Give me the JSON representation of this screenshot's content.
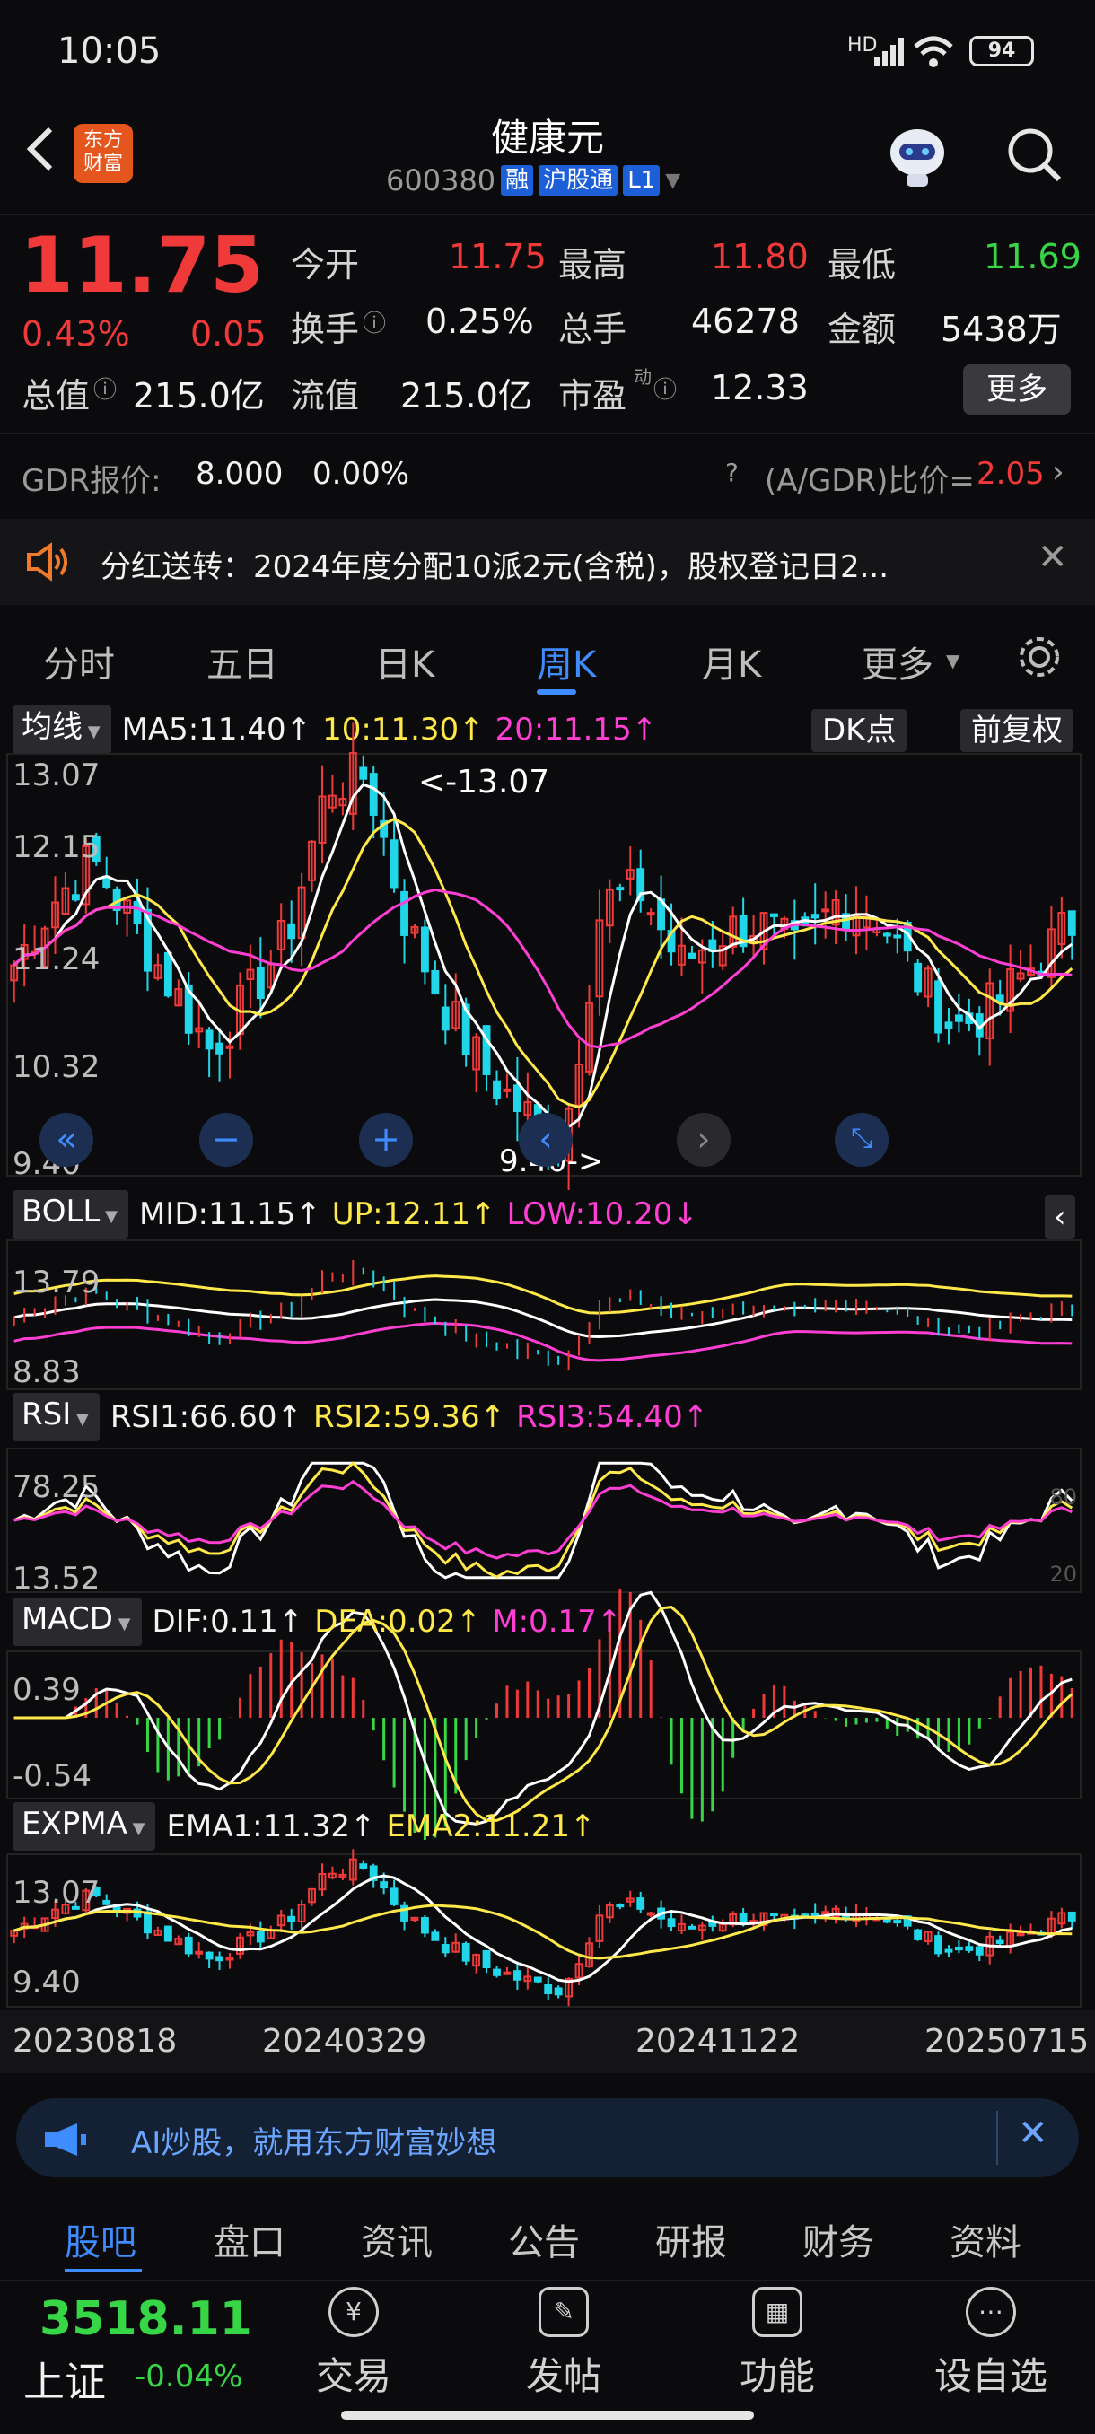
{
  "status_bar": {
    "time": "10:05",
    "battery": "94",
    "network": "HD"
  },
  "header": {
    "title": "健康元",
    "code": "600380",
    "tags": [
      "融",
      "沪股通",
      "L1"
    ],
    "logo_text": "东方\n财富"
  },
  "quote": {
    "price": "11.75",
    "change_pct": "0.43%",
    "change": "0.05",
    "open_label": "今开",
    "open": "11.75",
    "high_label": "最高",
    "high": "11.80",
    "low_label": "最低",
    "low": "11.69",
    "turnover_label": "换手",
    "turnover": "0.25%",
    "volume_label": "总手",
    "volume": "46278",
    "amount_label": "金额",
    "amount": "5438万",
    "mktcap_label": "总值",
    "mktcap": "215.0亿",
    "float_label": "流值",
    "float": "215.0亿",
    "pe_label": "市盈",
    "pe_sup": "动",
    "pe": "12.33",
    "more_label": "更多"
  },
  "gdr": {
    "label": "GDR报价:",
    "price": "8.000",
    "pct": "0.00%",
    "ratio_label": "(A/GDR)比价=",
    "ratio": "2.05"
  },
  "notice": {
    "text": "分红送转：2024年度分配10派2元(含税)，股权登记日2..."
  },
  "tabs": [
    "分时",
    "五日",
    "日K",
    "周K",
    "月K",
    "更多"
  ],
  "active_tab": "周K",
  "chart": {
    "ma": {
      "selector": "均线",
      "ma5": "MA5:11.40↑",
      "ma10": "10:11.30↑",
      "ma20": "20:11.15↑",
      "dk": "DK点",
      "adjust": "前复权"
    },
    "price_axis": [
      "13.07",
      "12.15",
      "11.24",
      "10.32",
      "9.40"
    ],
    "high_marker": "<-13.07",
    "low_marker": "9.40->",
    "boll": {
      "selector": "BOLL",
      "mid": "MID:11.15↑",
      "up": "UP:12.11↑",
      "low": "LOW:10.20↓",
      "axis_top": "13.79",
      "axis_bottom": "8.83"
    },
    "rsi": {
      "selector": "RSI",
      "rsi1": "RSI1:66.60↑",
      "rsi2": "RSI2:59.36↑",
      "rsi3": "RSI3:54.40↑",
      "axis_top": "78.25",
      "axis_bottom": "13.52",
      "level_high": "80",
      "level_low": "20"
    },
    "macd": {
      "selector": "MACD",
      "dif": "DIF:0.11↑",
      "dea": "DEA:0.02↑",
      "m": "M:0.17↑",
      "axis_top": "0.39",
      "axis_bottom": "-0.54"
    },
    "expma": {
      "selector": "EXPMA",
      "ema1": "EMA1:11.32↑",
      "ema2": "EMA2:11.21↑",
      "axis_top": "13.07",
      "axis_bottom": "9.40"
    },
    "dates": [
      "20230818",
      "20240329",
      "20241122",
      "20250715"
    ],
    "colors": {
      "up": "#f03a3a",
      "down": "#21d6e8",
      "ma5": "#ffffff",
      "ma10": "#ffe84a",
      "ma20": "#ff3fd4"
    }
  },
  "banner": {
    "text": "AI炒股，就用东方财富妙想"
  },
  "bottom_tabs": [
    "股吧",
    "盘口",
    "资讯",
    "公告",
    "研报",
    "财务",
    "资料"
  ],
  "nav": {
    "index_value": "3518.11",
    "index_name": "上证",
    "index_change": "-0.04%",
    "items": [
      "交易",
      "发帖",
      "功能",
      "设自选"
    ]
  }
}
